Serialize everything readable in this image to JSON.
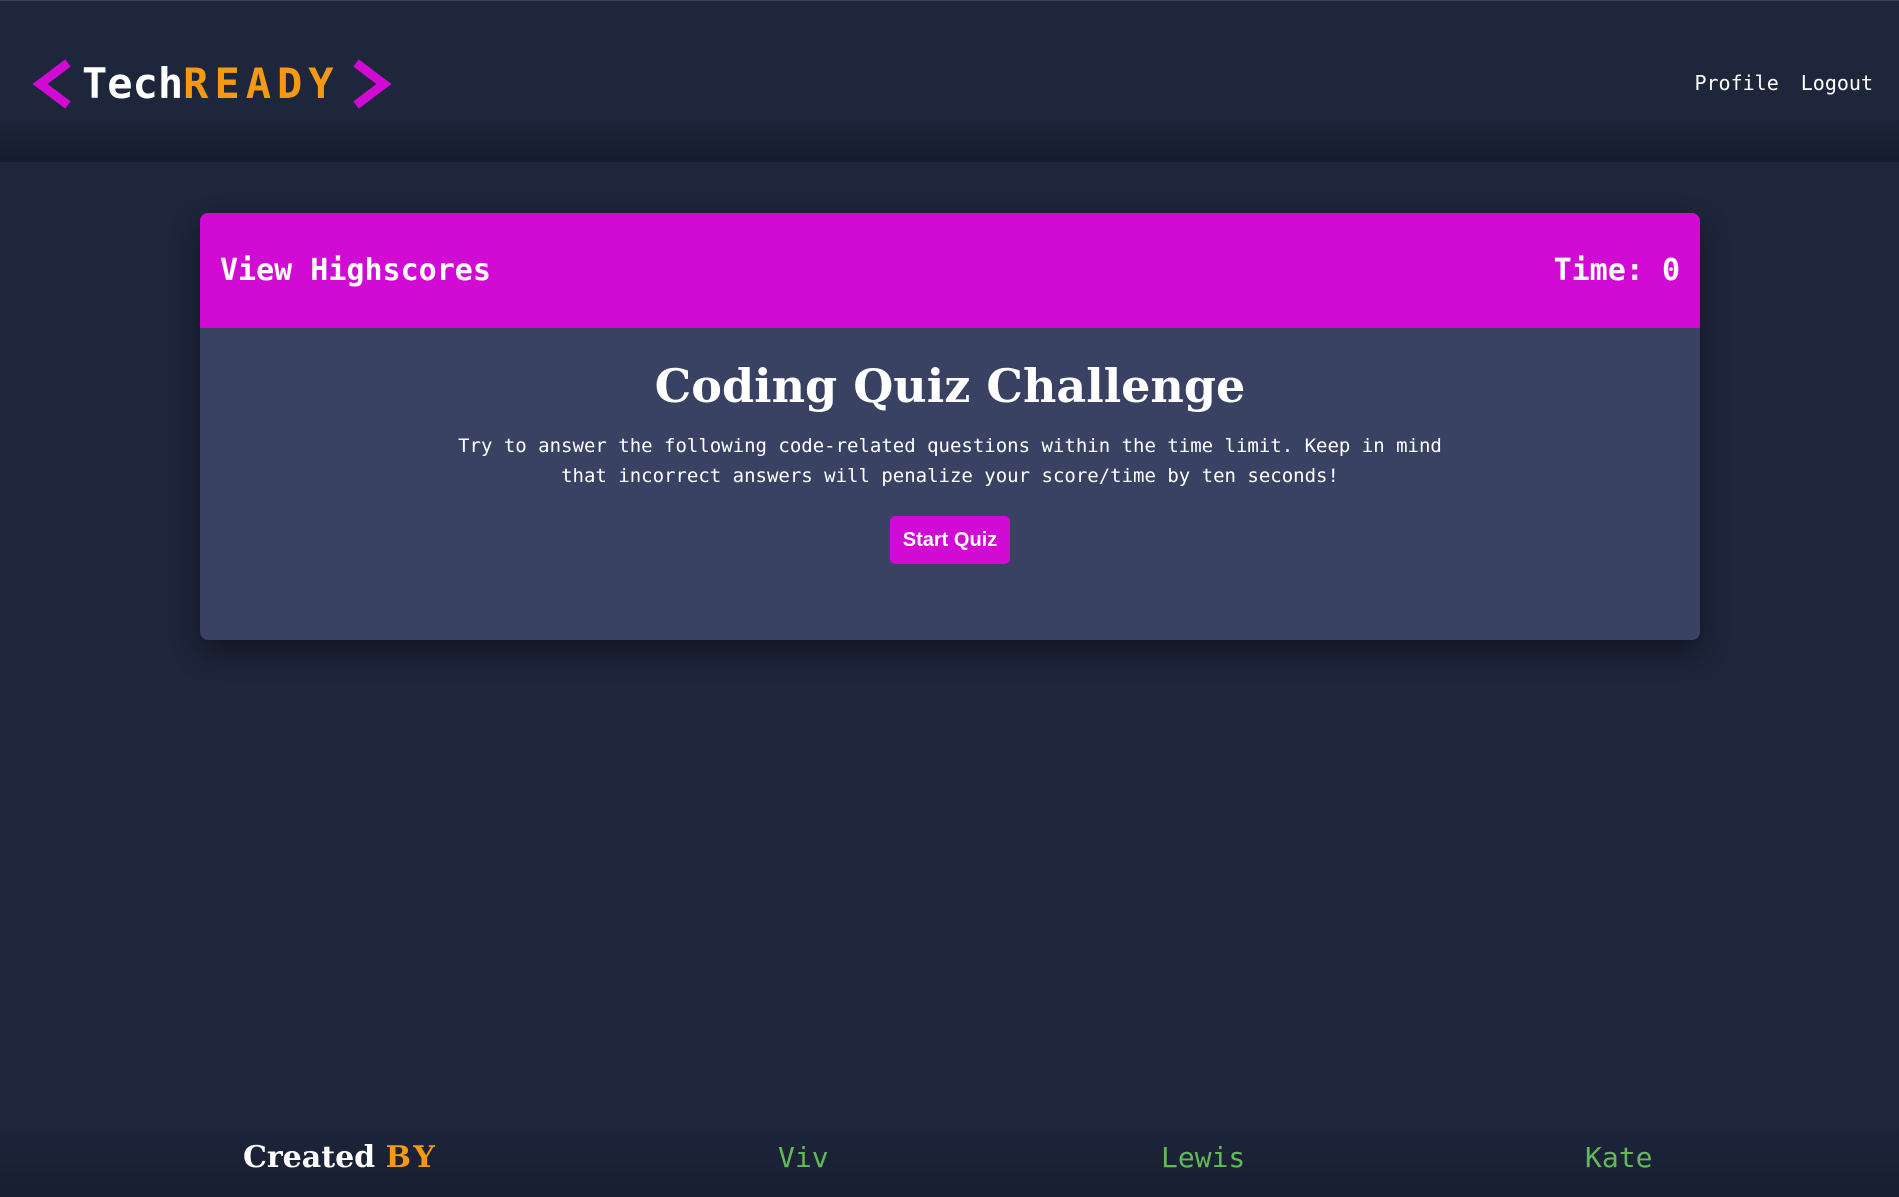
{
  "header": {
    "logo": {
      "tech": "Tech",
      "ready": "READY",
      "bracket_color": "#d10ad4"
    },
    "nav": {
      "profile": "Profile",
      "logout": "Logout"
    }
  },
  "quiz": {
    "highscores_link": "View Highscores",
    "timer_label": "Time:",
    "timer_value": "0",
    "title": "Coding Quiz Challenge",
    "description": "Try to answer the following code-related questions within the time limit. Keep in mind that incorrect answers will penalize your score/time by ten seconds!",
    "start_button": "Start Quiz"
  },
  "footer": {
    "created": "Created",
    "by": "BY",
    "authors": [
      "Viv",
      "Lewis",
      "Kate"
    ]
  },
  "colors": {
    "background": "#1e263c",
    "card": "#3a4264",
    "accent_magenta": "#d10ad4",
    "accent_orange": "#f39a12",
    "author_green": "#63b859"
  }
}
